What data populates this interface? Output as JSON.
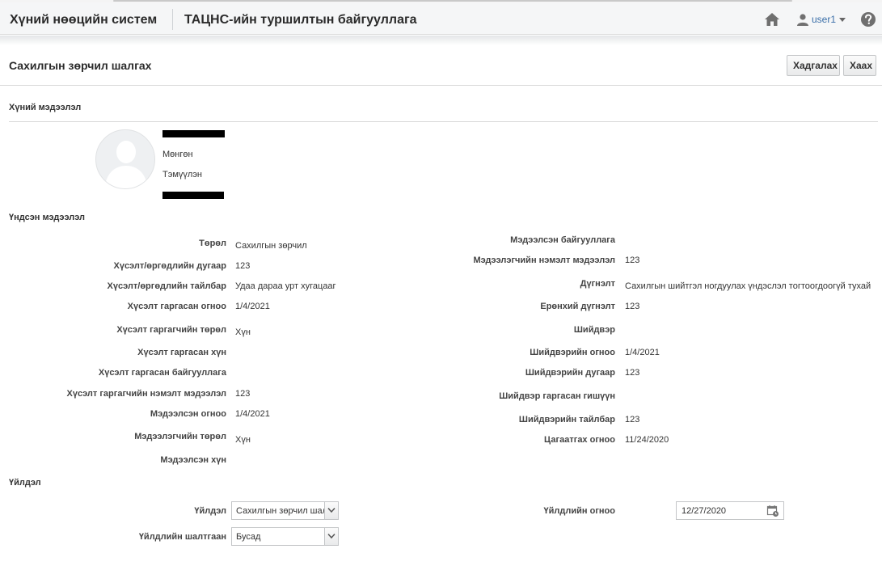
{
  "header": {
    "app_title": "Хүний нөөцийн систем",
    "org_title": "ТАЦНС-ийн туршилтын байгууллага",
    "user_name": "user1"
  },
  "page": {
    "title": "Сахилгын зөрчил шалгах",
    "save_label": "Хадгалах",
    "close_label": "Хаах"
  },
  "sections": {
    "person": "Хүний мэдээлэл",
    "main": "Үндсэн мэдээлэл",
    "action": "Үйлдэл"
  },
  "person": {
    "names": [
      "Мөнгөн",
      "Тэмүүлэн"
    ]
  },
  "left_fields": [
    {
      "label": "Төрөл",
      "value": "Сахилгын зөрчил"
    },
    {
      "label": "Хүсэлт/өргөдлийн дугаар",
      "value": "123"
    },
    {
      "label": "Хүсэлт/өргөдлийн тайлбар",
      "value": "Удаа дараа урт хугацааг"
    },
    {
      "label": "Хүсэлт гаргасан огноо",
      "value": "1/4/2021"
    },
    {
      "label": "Хүсэлт гаргагчийн төрөл",
      "value": "Хүн"
    },
    {
      "label": "Хүсэлт гаргасан хүн",
      "value": ""
    },
    {
      "label": "Хүсэлт гаргасан байгууллага",
      "value": ""
    },
    {
      "label": "Хүсэлт гаргагчийн нэмэлт мэдээлэл",
      "value": "123"
    },
    {
      "label": "Мэдээлсэн огноо",
      "value": "1/4/2021"
    },
    {
      "label": "Мэдээлэгчийн төрөл",
      "value": "Хүн"
    },
    {
      "label": "Мэдээлсэн хүн",
      "value": ""
    }
  ],
  "right_fields": [
    {
      "label": "Мэдээлсэн байгууллага",
      "value": ""
    },
    {
      "label": "Мэдээлэгчийн нэмэлт мэдээлэл",
      "value": "123"
    },
    {
      "label": "Дүгнэлт",
      "value": "Сахилгын шийтгэл ногдуулах үндэслэл тогтоогдоогүй тухай"
    },
    {
      "label": "Ерөнхий дүгнэлт",
      "value": "123"
    },
    {
      "label": "Шийдвэр",
      "value": ""
    },
    {
      "label": "Шийдвэрийн огноо",
      "value": "1/4/2021"
    },
    {
      "label": "Шийдвэрийн дугаар",
      "value": "123"
    },
    {
      "label": "Шийдвэр гаргасан гишүүн",
      "value": ""
    },
    {
      "label": "Шийдвэрийн тайлбар",
      "value": "123"
    },
    {
      "label": "Цагаатгах огноо",
      "value": "11/24/2020"
    }
  ],
  "action": {
    "action_label": "Үйлдэл",
    "action_value": "Сахилгын зөрчил шал",
    "reason_label": "Үйлдлийн шалтгаан",
    "reason_value": "Бусад",
    "date_label": "Үйлдлийн огноо",
    "date_value": "12/27/2020"
  },
  "icons": {
    "home": "home-icon",
    "user": "user-icon",
    "help": "help-icon",
    "calendar": "calendar-icon",
    "dropdown": "chevron-down-icon"
  }
}
